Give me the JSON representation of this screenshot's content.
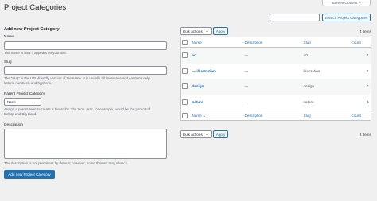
{
  "page": {
    "title": "Project Categories"
  },
  "screen_options": {
    "label": "Screen Options"
  },
  "search": {
    "placeholder": "",
    "button_label": "Search Project Categories"
  },
  "form": {
    "heading": "Add new Project Category",
    "name": {
      "label": "Name",
      "value": "",
      "help": "The name is how it appears on your site."
    },
    "slug": {
      "label": "Slug",
      "value": "",
      "help_lines": [
        "The “slug” is the URL-friendly version of the name. It is usually all lowercase and contains only",
        "letters, numbers, and hyphens."
      ]
    },
    "parent": {
      "label": "Parent Project Category",
      "selected": "None",
      "help_lines": [
        "Assign a parent term to create a hierarchy. The term Jazz, for example, would be the parent of",
        "Bebop and Big Band."
      ]
    },
    "description": {
      "label": "Description",
      "value": "",
      "help_lines": [
        "The description is not prominent by default; however, some themes may show it."
      ]
    },
    "submit_label": "Add new Project Category"
  },
  "bulk": {
    "selected": "Bulk actions",
    "apply_label": "Apply"
  },
  "items_count": "4 items",
  "table": {
    "columns": {
      "name": "Name",
      "description": "Description",
      "slug": "Slug",
      "count": "Count"
    },
    "rows": [
      {
        "name": "art",
        "description": "—",
        "slug": "art",
        "count": "1"
      },
      {
        "name": "— illustration",
        "description": "—",
        "slug": "illustration",
        "count": "1"
      },
      {
        "name": "design",
        "description": "—",
        "slug": "design",
        "count": "1"
      },
      {
        "name": "nature",
        "description": "—",
        "slug": "nature",
        "count": "1"
      }
    ]
  },
  "icons": {
    "sort": "sort-arrow-icon",
    "chevron": "chevron-down-icon"
  }
}
